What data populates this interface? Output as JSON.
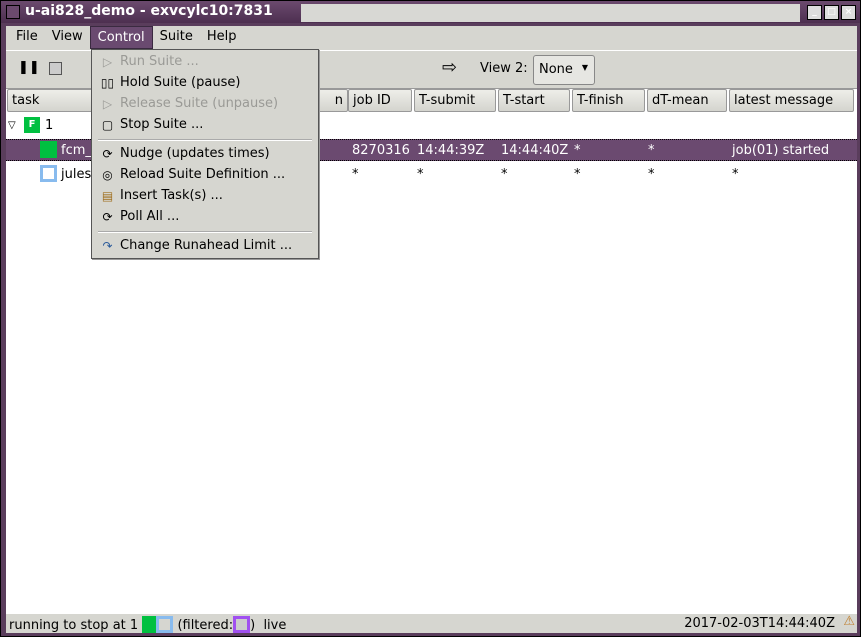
{
  "window": {
    "title": "u-ai828_demo - exvcylc10:7831",
    "buttons": [
      "_",
      "□",
      "×"
    ]
  },
  "menubar": [
    {
      "label": "File"
    },
    {
      "label": "View"
    },
    {
      "label": "Control",
      "active": true
    },
    {
      "label": "Suite"
    },
    {
      "label": "Help"
    }
  ],
  "toolbar": {
    "view2_label": "View 2:",
    "view2_value": "None"
  },
  "control_menu": [
    {
      "label": "Run Suite ...",
      "icon": "play-icon",
      "disabled": true
    },
    {
      "label": "Hold Suite (pause)",
      "icon": "pause-icon",
      "disabled": false
    },
    {
      "label": "Release Suite (unpause)",
      "icon": "play-icon",
      "disabled": true
    },
    {
      "label": "Stop Suite ...",
      "icon": "stop-icon",
      "disabled": false
    },
    {
      "label": "Nudge (updates times)",
      "icon": "refresh-icon",
      "disabled": false
    },
    {
      "label": "Reload Suite Definition ...",
      "icon": "disc-icon",
      "disabled": false
    },
    {
      "label": "Insert Task(s) ...",
      "icon": "clipboard-icon",
      "disabled": false
    },
    {
      "label": "Poll All ...",
      "icon": "refresh-icon",
      "disabled": false
    },
    {
      "label": "Change Runahead Limit ...",
      "icon": "redo-icon",
      "disabled": false
    }
  ],
  "columns": [
    "task",
    "n",
    "job ID",
    "T-submit",
    "T-start",
    "T-finish",
    "dT-mean",
    "latest message"
  ],
  "tree": {
    "family": {
      "label": "1",
      "badge": "F",
      "color": "#00c040"
    },
    "rows": [
      {
        "task": "fcm_",
        "job_id": "8270316",
        "t_submit": "14:44:39Z",
        "t_start": "14:44:40Z",
        "t_finish": "*",
        "dt_mean": "*",
        "message": "job(01) started",
        "state_color": "#00c040",
        "selected": true
      },
      {
        "task": "jules",
        "job_id": "*",
        "t_submit": "*",
        "t_start": "*",
        "t_finish": "*",
        "dt_mean": "*",
        "message": "*",
        "state_color": "#88bbee",
        "selected": false
      }
    ]
  },
  "status": {
    "text": "running to stop at 1",
    "filtered": "(filtered:",
    "close": ")",
    "mode": "live",
    "time": "2017-02-03T14:44:40Z"
  },
  "colors": {
    "accent": "#6b4a70",
    "running": "#00c040",
    "waiting": "#88bbee",
    "filtered": "#a050f0"
  }
}
